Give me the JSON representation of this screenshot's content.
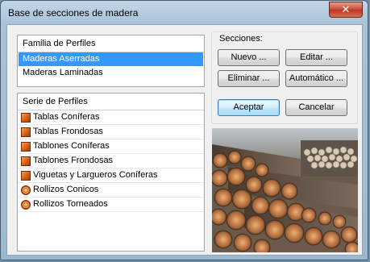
{
  "window": {
    "title": "Base de secciones de madera",
    "close_glyph": "✕"
  },
  "familia": {
    "header": "Familia de Perfiles",
    "items": [
      {
        "label": "Maderas Aserradas",
        "selected": true
      },
      {
        "label": "Maderas Laminadas",
        "selected": false
      }
    ]
  },
  "serie": {
    "header": "Serie de Perfiles",
    "items": [
      {
        "label": "Tablas Coníferas",
        "icon": "board-icon"
      },
      {
        "label": "Tablas Frondosas",
        "icon": "board-icon"
      },
      {
        "label": "Tablones Coníferas",
        "icon": "board-icon"
      },
      {
        "label": "Tablones Frondosas",
        "icon": "board-icon"
      },
      {
        "label": "Viguetas y Largueros Coníferas",
        "icon": "board-icon"
      },
      {
        "label": "Rollizos Conicos",
        "icon": "log-icon"
      },
      {
        "label": "Rollizos Torneados",
        "icon": "log-icon"
      }
    ]
  },
  "secciones": {
    "label": "Secciones:",
    "nuevo": "Nuevo ...",
    "editar": "Editar ...",
    "eliminar": "Eliminar ...",
    "automatico": "Automático ..."
  },
  "actions": {
    "aceptar": "Aceptar",
    "cancelar": "Cancelar"
  },
  "colors": {
    "selection": "#3399ff",
    "titlebar": "#a9c3d9",
    "close": "#c64a33"
  }
}
